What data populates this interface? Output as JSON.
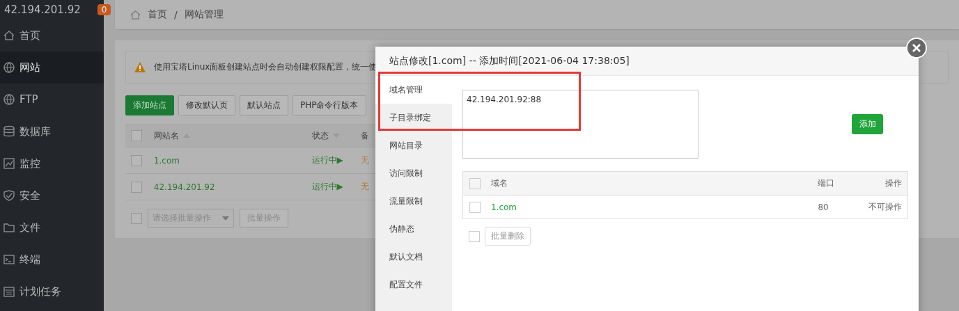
{
  "sidebar": {
    "server": "42.194.201.92",
    "badge": "0",
    "items": [
      {
        "label": "首页",
        "selected": false
      },
      {
        "label": "网站",
        "selected": true
      },
      {
        "label": "FTP",
        "selected": false
      },
      {
        "label": "数据库",
        "selected": false
      },
      {
        "label": "监控",
        "selected": false
      },
      {
        "label": "安全",
        "selected": false
      },
      {
        "label": "文件",
        "selected": false
      },
      {
        "label": "终端",
        "selected": false
      },
      {
        "label": "计划任务",
        "selected": false
      }
    ]
  },
  "breadcrumb": {
    "items": [
      "首页",
      "网站管理"
    ],
    "separator": "/"
  },
  "alert": "使用宝塔Linux面板创建站点时会自动创建权限配置，统一使",
  "toolbar": [
    {
      "label": "添加站点",
      "kind": "primary"
    },
    {
      "label": "修改默认页",
      "kind": "default"
    },
    {
      "label": "默认站点",
      "kind": "default"
    },
    {
      "label": "PHP命令行版本",
      "kind": "default"
    }
  ],
  "site_table": {
    "all_checked": false,
    "columns": [
      "网站名",
      "状态",
      "备"
    ],
    "rows": [
      {
        "checked": false,
        "name": "1.com",
        "status": "运行中▶",
        "column_3": "无"
      },
      {
        "checked": false,
        "name": "42.194.201.92",
        "status": "运行中▶",
        "column_3": "无"
      }
    ]
  },
  "batch": {
    "checked": false,
    "placeholder": "请选择批量操作",
    "button": "批量操作"
  },
  "modal": {
    "title": "站点修改[1.com] -- 添加时间[2021-06-04 17:38:05]",
    "menu": [
      {
        "label": "域名管理",
        "selected": true
      },
      {
        "label": "子目录绑定",
        "selected": false
      },
      {
        "label": "网站目录",
        "selected": false
      },
      {
        "label": "访问限制",
        "selected": false
      },
      {
        "label": "流量限制",
        "selected": false
      },
      {
        "label": "伪静态",
        "selected": false
      },
      {
        "label": "默认文档",
        "selected": false
      },
      {
        "label": "配置文件",
        "selected": false
      }
    ],
    "domain_input": {
      "value": "42.194.201.92:88"
    },
    "add_button": "添加",
    "domain_table": {
      "all_checked": false,
      "columns": [
        "域名",
        "端口",
        "操作"
      ],
      "rows": [
        {
          "checked": false,
          "domain": "1.com",
          "port": "80",
          "action": "不可操作"
        }
      ]
    },
    "bulk_delete": {
      "checked": false,
      "label": "批量删除",
      "disabled": true
    }
  }
}
